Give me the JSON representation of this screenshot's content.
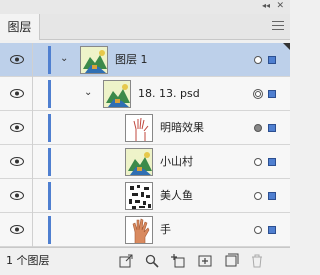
{
  "panel": {
    "tab_label": "图层",
    "collapse_icon": "double-chevron-left",
    "close_icon": "x",
    "menu_icon": "hamburger"
  },
  "layers": [
    {
      "name": "图层 1",
      "level": 0,
      "expanded": true,
      "selected": true,
      "target": "circle",
      "thumbnail": "mountain-village"
    },
    {
      "name": "18. 13. psd",
      "level": 1,
      "expanded": true,
      "selected": false,
      "target": "double-circle",
      "thumbnail": "mountain-village"
    },
    {
      "name": "明暗效果",
      "level": 2,
      "selected": false,
      "target": "filled-circle",
      "thumbnail": "hand-sketch"
    },
    {
      "name": "小山村",
      "level": 2,
      "selected": false,
      "target": "circle",
      "thumbnail": "mountain-village"
    },
    {
      "name": "美人鱼",
      "level": 2,
      "selected": false,
      "target": "circle",
      "thumbnail": "mermaid-pattern"
    },
    {
      "name": "手",
      "level": 2,
      "selected": false,
      "target": "circle",
      "thumbnail": "hand-color"
    }
  ],
  "footer": {
    "layer_count": "1 个图层",
    "buttons": [
      "export-icon",
      "search-icon",
      "make-clipping-mask-icon",
      "new-sublayer-icon",
      "new-layer-icon",
      "delete-icon"
    ]
  },
  "colors": {
    "selection_bg": "#bdd0ea",
    "layer_color": "#4f7fd0"
  }
}
